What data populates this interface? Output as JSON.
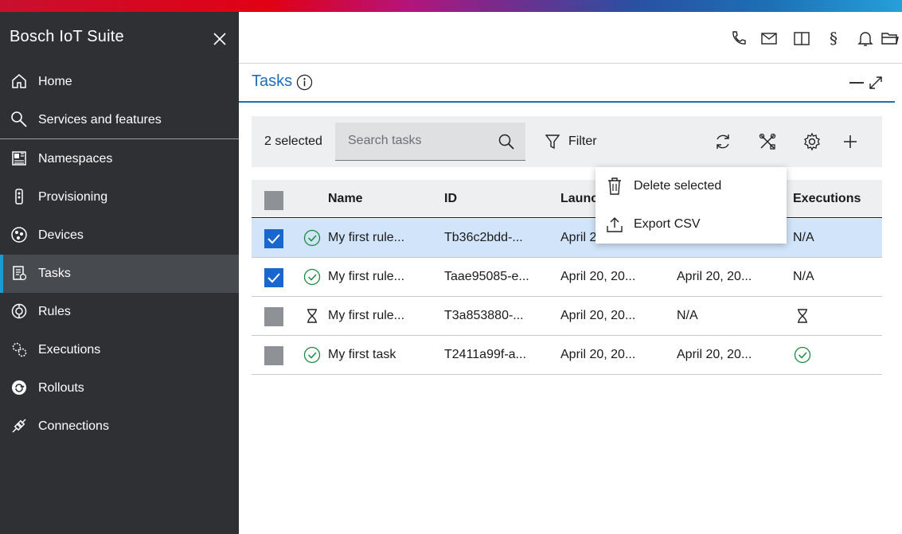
{
  "app": {
    "title": "Bosch IoT Suite"
  },
  "sidebar": {
    "items": [
      {
        "label": "Home",
        "icon": "home-icon"
      },
      {
        "label": "Services and features",
        "icon": "search-icon"
      },
      {
        "label": "Namespaces",
        "icon": "namespaces-icon"
      },
      {
        "label": "Provisioning",
        "icon": "provisioning-icon"
      },
      {
        "label": "Devices",
        "icon": "devices-icon"
      },
      {
        "label": "Tasks",
        "icon": "tasks-icon",
        "active": true
      },
      {
        "label": "Rules",
        "icon": "rules-icon"
      },
      {
        "label": "Executions",
        "icon": "executions-icon"
      },
      {
        "label": "Rollouts",
        "icon": "rollouts-icon"
      },
      {
        "label": "Connections",
        "icon": "connections-icon"
      }
    ]
  },
  "header": {
    "icons": [
      "phone-icon",
      "mail-icon",
      "book-icon",
      "legal-icon",
      "bell-icon",
      "folder-icon"
    ]
  },
  "panel": {
    "title": "Tasks"
  },
  "toolbar": {
    "selected_text": "2 selected",
    "search_placeholder": "Search tasks",
    "filter_label": "Filter"
  },
  "table": {
    "columns": [
      "Name",
      "ID",
      "Launc",
      "Executions"
    ],
    "rows": [
      {
        "selected": true,
        "status": "success",
        "name": "My first rule...",
        "id": "Tb36c2bdd-...",
        "launched": "April 2",
        "col4": "",
        "executions": "N/A"
      },
      {
        "selected": true,
        "status": "success",
        "name": "My first rule...",
        "id": "Taae95085-e...",
        "launched": "April 20, 20...",
        "col4": "April 20, 20...",
        "executions": "N/A"
      },
      {
        "selected": false,
        "status": "pending",
        "name": "My first rule...",
        "id": "T3a853880-...",
        "launched": "April 20, 20...",
        "col4": "N/A",
        "executions": ""
      },
      {
        "selected": false,
        "status": "success",
        "name": "My first task",
        "id": "T2411a99f-a...",
        "launched": "April 20, 20...",
        "col4": "April 20, 20...",
        "executions": ""
      }
    ]
  },
  "menu": {
    "items": [
      {
        "label": "Delete selected",
        "icon": "trash-icon"
      },
      {
        "label": "Export CSV",
        "icon": "export-icon"
      }
    ]
  },
  "colors": {
    "accent": "#1e6fb7",
    "sidebar": "#2e3033",
    "success": "#1b8a3f",
    "checkbox": "#1967ce"
  }
}
